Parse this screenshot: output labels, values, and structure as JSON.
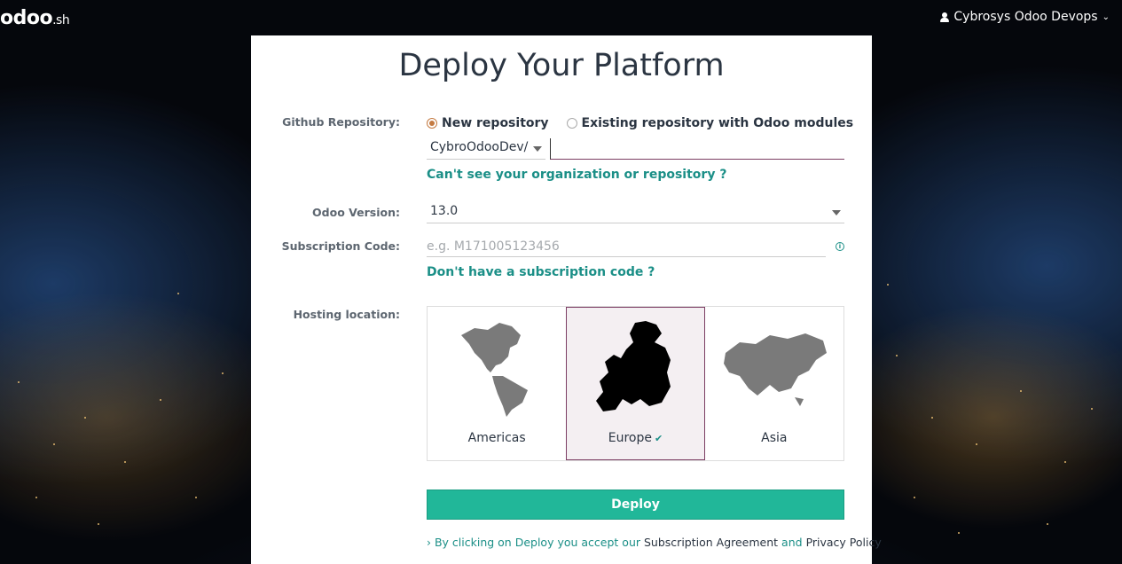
{
  "header": {
    "logo_main": "odoo",
    "logo_suffix": ".sh",
    "user_name": "Cybrosys Odoo Devops"
  },
  "page": {
    "title": "Deploy Your Platform"
  },
  "repo": {
    "label": "Github Repository:",
    "option_new": "New repository",
    "option_existing": "Existing repository with Odoo modules",
    "selected_option": "New repository",
    "organization": "CybroOdooDev/",
    "repo_name": "",
    "help_link": "Can't see your organization or repository ?"
  },
  "version": {
    "label": "Odoo Version:",
    "value": "13.0"
  },
  "subscription": {
    "label": "Subscription Code:",
    "placeholder": "e.g. M171005123456",
    "value": "",
    "help_link": "Don't have a subscription code ?"
  },
  "hosting": {
    "label": "Hosting location:",
    "regions": [
      {
        "name": "Americas"
      },
      {
        "name": "Europe"
      },
      {
        "name": "Asia"
      }
    ],
    "selected": "Europe"
  },
  "deploy": {
    "button_label": "Deploy",
    "terms_prefix": "By clicking on Deploy you accept our",
    "agreement_link": "Subscription Agreement",
    "and_word": "and",
    "privacy_link": "Privacy Policy"
  },
  "colors": {
    "accent_teal": "#21b799",
    "link_teal": "#1b8f87",
    "brand_purple": "#7c3d63",
    "radio_orange": "#c47a41"
  }
}
